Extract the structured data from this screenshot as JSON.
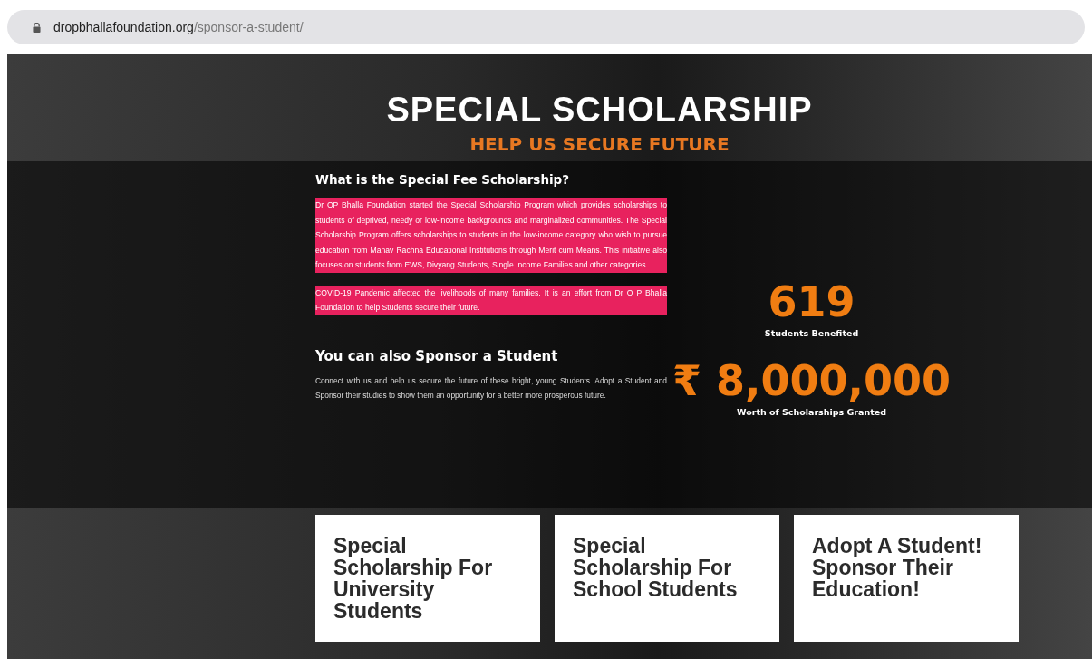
{
  "address_bar": {
    "domain": "dropbhallafoundation.org",
    "path": "/sponsor-a-student/"
  },
  "hero": {
    "title": "SPECIAL SCHOLARSHIP",
    "subtitle": "HELP US SECURE FUTURE"
  },
  "about": {
    "heading": "What is the Special Fee Scholarship?",
    "paragraphs": [
      {
        "text": "Dr OP Bhalla Foundation started the Special Scholarship Program which provides scholarships to students of deprived, needy or low-income backgrounds and marginalized communities. The Special Scholarship Program offers scholarships to students in the low-income category who wish to pursue education from Manav Rachna Educational Institutions through Merit cum Means. This initiative also focuses on students from EWS, Divyang Students, Single Income Families and other categories.",
        "highlighted": true
      },
      {
        "text": "COVID-19 Pandemic affected the livelihoods of many families. It is an effort from Dr O P Bhalla Foundation to help Students secure their future.",
        "highlighted": true
      }
    ]
  },
  "sponsor": {
    "heading": "You can also Sponsor a Student",
    "text": "Connect with us and help us secure the future of these bright, young Students. Adopt a Student and Sponsor their studies to show them an opportunity for a better more prosperous future."
  },
  "stats": [
    {
      "value": "619",
      "label": "Students Benefited"
    },
    {
      "value": "₹ 8,000,000",
      "label": "Worth of Scholarships Granted"
    }
  ],
  "cards": [
    {
      "title": "Special Scholarship For University Students"
    },
    {
      "title": "Special Scholarship For School Students"
    },
    {
      "title": "Adopt A Student! Sponsor Their Education!"
    }
  ]
}
